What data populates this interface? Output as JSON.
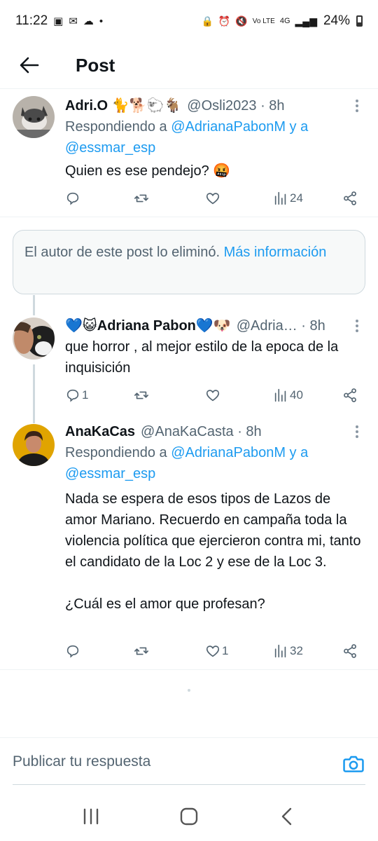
{
  "status_bar": {
    "time": "11:22",
    "battery": "24%",
    "network": "4G",
    "volte": "Vo LTE"
  },
  "header": {
    "title": "Post"
  },
  "tweets": [
    {
      "name": "Adri.O 🐈🐕🐑🐐",
      "handle": "@Osli2023 · 8h",
      "replying_prefix": "Respondiendo a",
      "mention1": "@AdrianaPabonM",
      "and_text": "y a",
      "mention2": "@essmar_esp",
      "text": "Quien es ese pendejo? 🤬",
      "replies": "",
      "likes": "",
      "views": "24"
    },
    {
      "name": "💙😺Adriana Pabon💙🐶",
      "handle": "@Adria… · 8h",
      "text": "que horror , al mejor estilo de la epoca de la inquisición",
      "replies": "1",
      "likes": "",
      "views": "40"
    },
    {
      "name": "AnaKaCas",
      "handle": "@AnaKaCasta · 8h",
      "replying_prefix": "Respondiendo a",
      "mention1": "@AdrianaPabonM",
      "and_text": "y a",
      "mention2": "@essmar_esp",
      "text": "Nada se espera de esos tipos de Lazos de amor Mariano. Recuerdo en campaña toda la violencia política que ejercieron contra mi, tanto el candidato de la Loc 2 y ese de la Loc 3.\n\n¿Cuál es el amor que profesan?",
      "replies": "",
      "likes": "1",
      "views": "32"
    }
  ],
  "deleted_notice": {
    "text": "El autor de este post lo eliminó.",
    "link": "Más información"
  },
  "compose": {
    "placeholder": "Publicar tu respuesta"
  },
  "colors": {
    "accent": "#1d9bf0",
    "secondary_text": "#536471",
    "divider": "#eff3f4"
  },
  "icons": [
    "back-arrow-icon",
    "reply-icon",
    "repost-icon",
    "like-icon",
    "views-icon",
    "share-icon",
    "more-icon",
    "camera-icon",
    "recents-icon",
    "home-icon",
    "nav-back-icon"
  ]
}
